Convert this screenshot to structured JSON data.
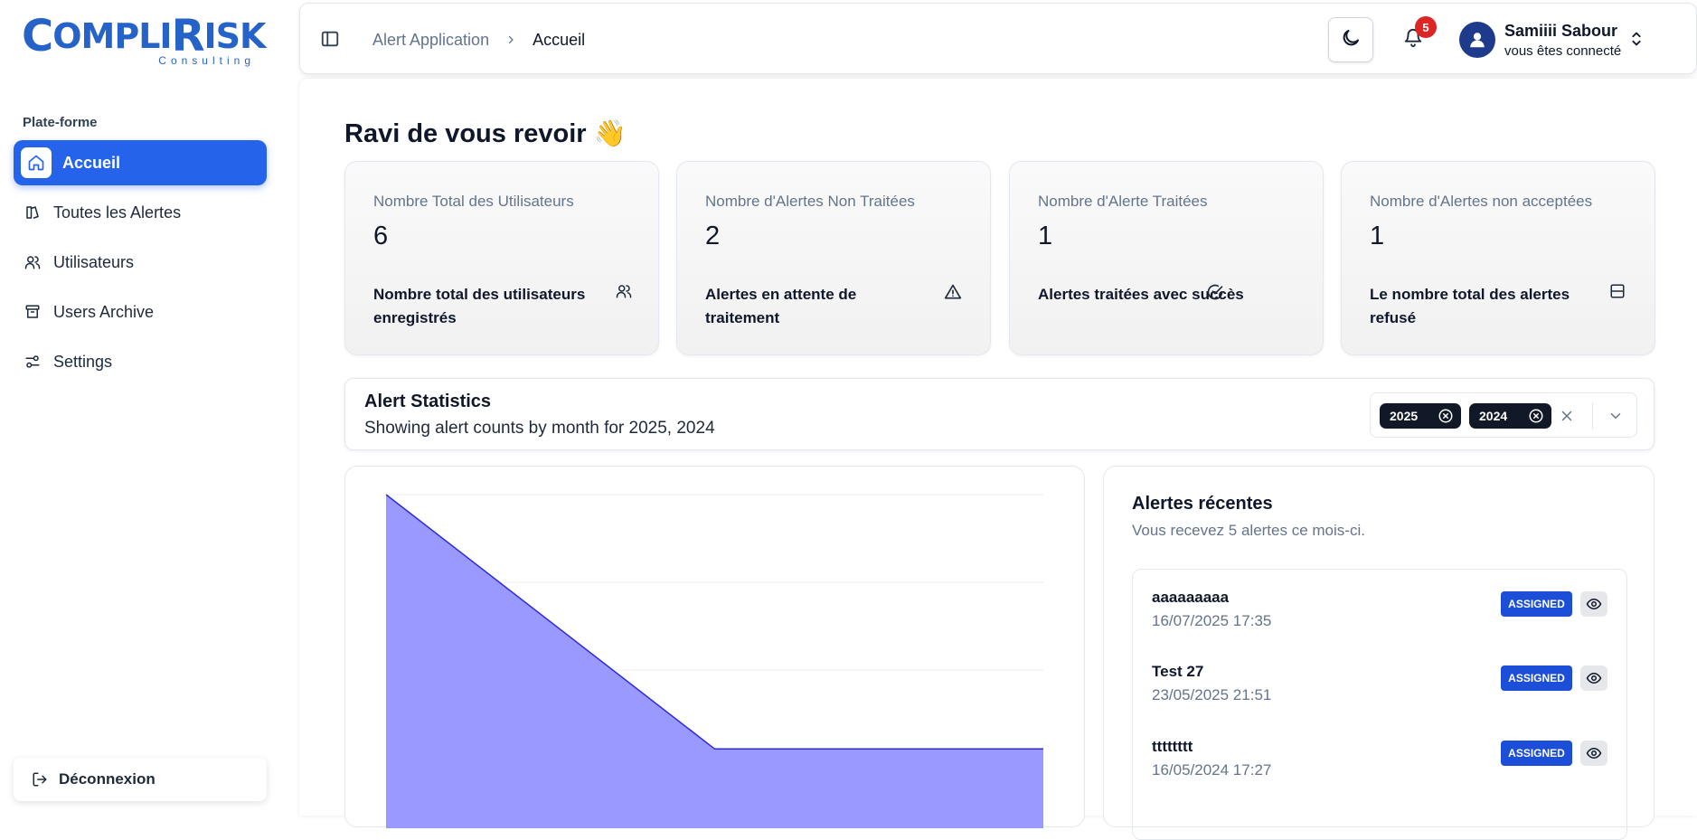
{
  "brand": {
    "logo_text": "COMPLIRISK",
    "logo_sub": "Consulting"
  },
  "sidebar": {
    "section_label": "Plate-forme",
    "items": [
      {
        "label": "Accueil",
        "icon": "home-icon",
        "active": true
      },
      {
        "label": "Toutes les Alertes",
        "icon": "alerts-icon",
        "active": false
      },
      {
        "label": "Utilisateurs",
        "icon": "users-icon",
        "active": false
      },
      {
        "label": "Users Archive",
        "icon": "archive-icon",
        "active": false
      },
      {
        "label": "Settings",
        "icon": "settings-icon",
        "active": false
      }
    ],
    "logout_label": "Déconnexion"
  },
  "header": {
    "breadcrumb": [
      "Alert Application",
      "Accueil"
    ],
    "notification_count": "5",
    "user_name": "Samiiii Sabour",
    "user_status": "vous êtes connecté"
  },
  "main": {
    "welcome": "Ravi de vous revoir 👋",
    "cards": [
      {
        "title": "Nombre Total des Utilisateurs",
        "value": "6",
        "desc": "Nombre total des utilisateurs enregistrés",
        "icon": "users-icon"
      },
      {
        "title": "Nombre d'Alertes Non Traitées",
        "value": "2",
        "desc": "Alertes en attente de traitement",
        "icon": "warning-icon"
      },
      {
        "title": "Nombre d'Alerte Traitées",
        "value": "1",
        "desc": "Alertes traitées avec succès",
        "icon": "check-circle-icon"
      },
      {
        "title": "Nombre d'Alertes non acceptées",
        "value": "1",
        "desc": "Le nombre total des alertes refusé",
        "icon": "rejected-icon"
      }
    ],
    "stats": {
      "title": "Alert Statistics",
      "subtitle": "Showing alert counts by month for 2025, 2024",
      "selected_years": [
        "2025",
        "2024"
      ]
    },
    "recent": {
      "title": "Alertes récentes",
      "subtitle": "Vous recevez 5 alertes ce mois-ci.",
      "items": [
        {
          "name": "aaaaaaaaa",
          "date": "16/07/2025 17:35",
          "status": "ASSIGNED"
        },
        {
          "name": "Test 27",
          "date": "23/05/2025 21:51",
          "status": "ASSIGNED"
        },
        {
          "name": "tttttttt",
          "date": "16/05/2024 17:27",
          "status": "ASSIGNED"
        }
      ]
    }
  },
  "colors": {
    "accent": "#2563eb",
    "badge": "#dc2626",
    "chart_fill": "#9999ff",
    "chart_line": "#2a2ae0"
  },
  "chart_data": {
    "type": "area",
    "x": [
      1,
      2,
      3
    ],
    "values": [
      4,
      2,
      2
    ],
    "ylim": [
      0,
      4
    ],
    "grid": true
  }
}
